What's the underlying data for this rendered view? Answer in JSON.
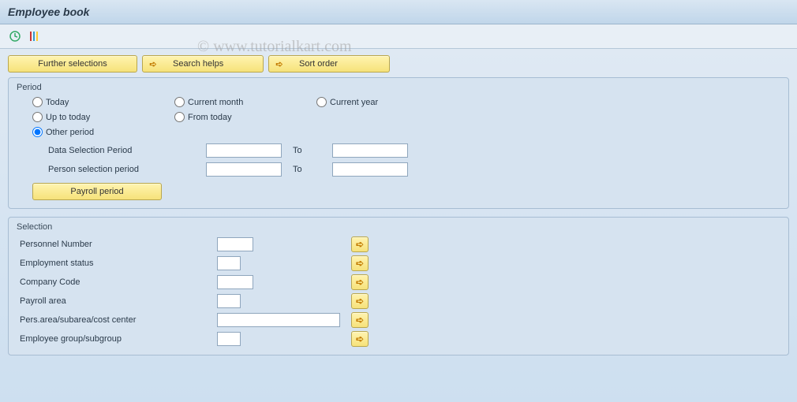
{
  "title": "Employee book",
  "watermark": "© www.tutorialkart.com",
  "toolbar": {
    "execute_icon": "execute",
    "variant_icon": "variant"
  },
  "buttons": {
    "further_selections": "Further selections",
    "search_helps": "Search helps",
    "sort_order": "Sort order",
    "payroll_period": "Payroll period"
  },
  "period": {
    "group_title": "Period",
    "radios": {
      "today": "Today",
      "current_month": "Current month",
      "current_year": "Current year",
      "up_to_today": "Up to today",
      "from_today": "From today",
      "other_period": "Other period"
    },
    "selected_radio": "other_period",
    "data_selection_label": "Data Selection Period",
    "person_selection_label": "Person selection period",
    "to_label": "To",
    "data_from": "",
    "data_to": "",
    "person_from": "",
    "person_to": ""
  },
  "selection": {
    "group_title": "Selection",
    "rows": [
      {
        "label": "Personnel Number",
        "value": "",
        "width": "narrow"
      },
      {
        "label": "Employment status",
        "value": "",
        "width": "tiny"
      },
      {
        "label": "Company Code",
        "value": "",
        "width": "narrow"
      },
      {
        "label": "Payroll area",
        "value": "",
        "width": "tiny"
      },
      {
        "label": "Pers.area/subarea/cost center",
        "value": "",
        "width": "wide"
      },
      {
        "label": "Employee group/subgroup",
        "value": "",
        "width": "tiny"
      }
    ]
  }
}
